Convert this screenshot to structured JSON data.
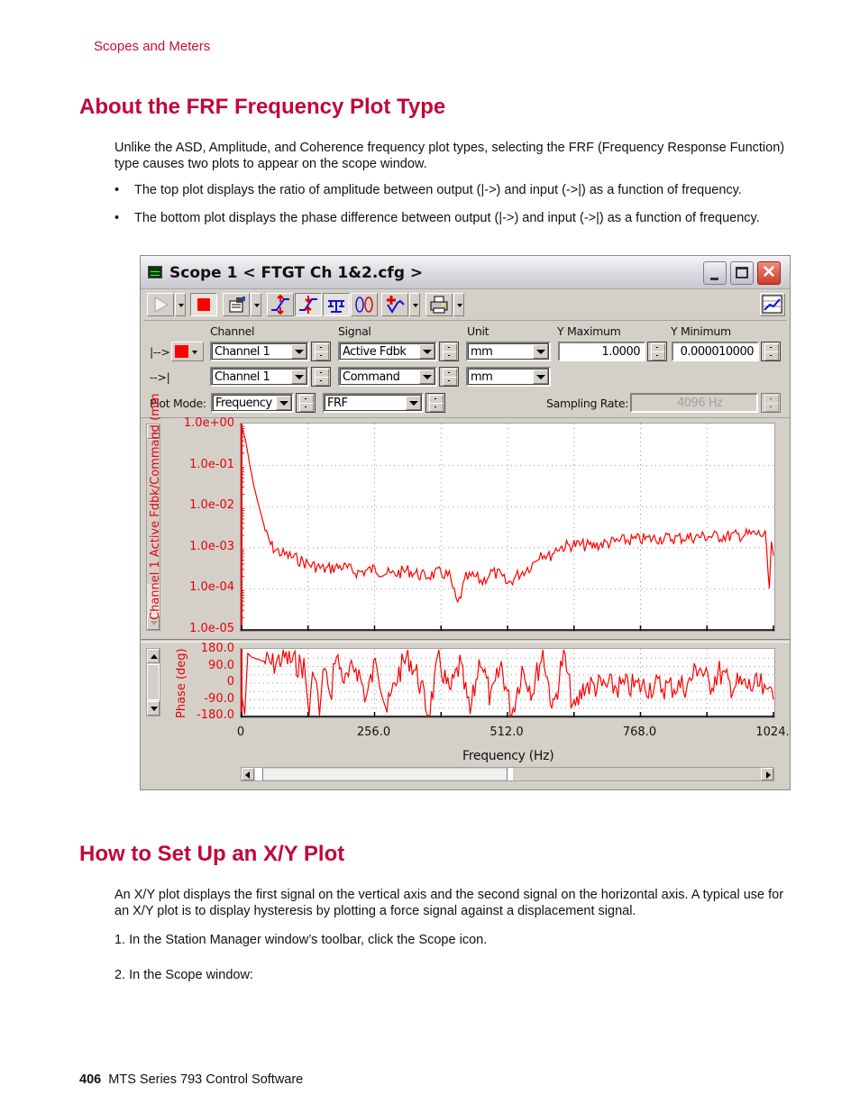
{
  "page": {
    "running_head": "Scopes and Meters",
    "section1": {
      "title": "About the FRF Frequency Plot Type",
      "intro": "Unlike the ASD, Amplitude, and Coherence frequency plot types, selecting the FRF (Frequency Response Function) type causes two plots to appear on the scope window.",
      "bullets": [
        "The top plot displays the ratio of amplitude between output (|->) and input (->|) as a function of frequency.",
        "The bottom plot displays the phase difference between output (|->) and input (->|) as a function of frequency."
      ]
    },
    "section2": {
      "title": "How to Set Up an X/Y Plot",
      "intro": "An X/Y plot displays the first signal on the vertical axis and the second signal on the horizontal axis. A typical use for an X/Y plot is to display hysteresis by plotting a force signal against a displacement signal.",
      "steps": [
        "1.  In the Station Manager window’s toolbar, click the Scope icon.",
        "2.  In the Scope window:"
      ]
    },
    "footer": {
      "page_number": "406",
      "doc_title": "MTS Series 793 Control Software"
    }
  },
  "scope_window": {
    "title": "Scope  1 < FTGT Ch 1&2.cfg >",
    "title_buttons": {
      "minimize": "minimize",
      "maximize": "maximize",
      "close": "✕"
    },
    "toolbar_icons": [
      "play-icon",
      "stop-icon",
      "properties-icon",
      "auto-scale-icon",
      "scale-in-icon",
      "balance-icon",
      "cycle-icon",
      "marker-icon",
      "print-icon",
      "chart-icon"
    ],
    "headers": {
      "channel": "Channel",
      "signal": "Signal",
      "unit": "Unit",
      "ymax": "Y Maximum",
      "ymin": "Y Minimum"
    },
    "rows": [
      {
        "prefix": "|-->",
        "channel": "Channel 1",
        "signal": "Active Fdbk",
        "unit": "mm",
        "ymax": "1.0000",
        "ymin": "0.000010000"
      },
      {
        "prefix": "-->|",
        "channel": "Channel 1",
        "signal": "Command",
        "unit": "mm"
      }
    ],
    "trace_color": "#ff0000",
    "plot_mode_label": "Plot Mode:",
    "plot_mode": "Frequency",
    "plot_type": "FRF",
    "sampling_rate_label": "Sampling Rate:",
    "sampling_rate": "4096  Hz"
  },
  "chart_data": [
    {
      "type": "line",
      "title": "",
      "ylabel": "Channel 1  Active Fdbk/Command (mm",
      "yscale": "log",
      "ylim": [
        1e-05,
        1
      ],
      "yticks": [
        "1.0e+00",
        "1.0e-01",
        "1.0e-02",
        "1.0e-03",
        "1.0e-04",
        "1.0e-05"
      ],
      "xlim": [
        0,
        1024
      ],
      "grid": true,
      "series_color": "#ff0000",
      "x": [
        0,
        8,
        16,
        24,
        32,
        40,
        48,
        56,
        64,
        80,
        96,
        112,
        128,
        160,
        192,
        224,
        256,
        288,
        320,
        352,
        384,
        400,
        416,
        432,
        448,
        464,
        480,
        496,
        512,
        528,
        544,
        560,
        576,
        592,
        608,
        640,
        672,
        704,
        736,
        768,
        800,
        832,
        864,
        896,
        928,
        960,
        992,
        1008,
        1016,
        1020,
        1024
      ],
      "values": [
        0.9,
        0.4,
        0.1,
        0.03,
        0.012,
        0.005,
        0.002,
        0.0012,
        0.0009,
        0.0007,
        0.0006,
        0.0005,
        0.0004,
        0.0003,
        0.00035,
        0.00025,
        0.0003,
        0.00022,
        0.00028,
        0.0002,
        0.00025,
        0.0002,
        4e-05,
        0.00018,
        0.0002,
        0.00015,
        0.00025,
        0.00022,
        0.00013,
        0.0002,
        0.00028,
        0.0004,
        0.0008,
        0.0006,
        0.001,
        0.0012,
        0.0011,
        0.0013,
        0.0015,
        0.0016,
        0.0017,
        0.0017,
        0.0018,
        0.0019,
        0.0019,
        0.002,
        0.0022,
        0.002,
        0.0001,
        0.001,
        0.0007
      ]
    },
    {
      "type": "line",
      "title": "",
      "ylabel": "Phase (deg)",
      "xlabel": "Frequency (Hz)",
      "ylim": [
        -180,
        180
      ],
      "yticks": [
        "180.0",
        "90.0",
        "0",
        "-90.0",
        "-180.0"
      ],
      "xlim": [
        0,
        1024
      ],
      "xticks": [
        "0",
        "256.0",
        "512.0",
        "768.0",
        "1024."
      ],
      "grid": true,
      "series_color": "#ff0000",
      "x": [
        0,
        6,
        12,
        20,
        40,
        60,
        80,
        100,
        120,
        130,
        140,
        150,
        160,
        170,
        180,
        200,
        220,
        240,
        260,
        280,
        300,
        320,
        340,
        360,
        380,
        400,
        420,
        440,
        460,
        480,
        500,
        520,
        540,
        560,
        580,
        600,
        620,
        640,
        660,
        700,
        740,
        780,
        820,
        860,
        880,
        900,
        920,
        940,
        960,
        980,
        1000,
        1010,
        1020,
        1024
      ],
      "values": [
        -60,
        -170,
        160,
        140,
        120,
        100,
        140,
        110,
        90,
        -160,
        100,
        -180,
        120,
        -120,
        160,
        0,
        100,
        -80,
        130,
        -150,
        40,
        150,
        30,
        -170,
        130,
        -60,
        100,
        -170,
        150,
        -100,
        100,
        -170,
        80,
        -40,
        170,
        -150,
        160,
        -160,
        -10,
        -20,
        -20,
        -15,
        -20,
        -10,
        100,
        -10,
        60,
        -10,
        -10,
        -20,
        -20,
        -90,
        0,
        -20
      ]
    }
  ]
}
